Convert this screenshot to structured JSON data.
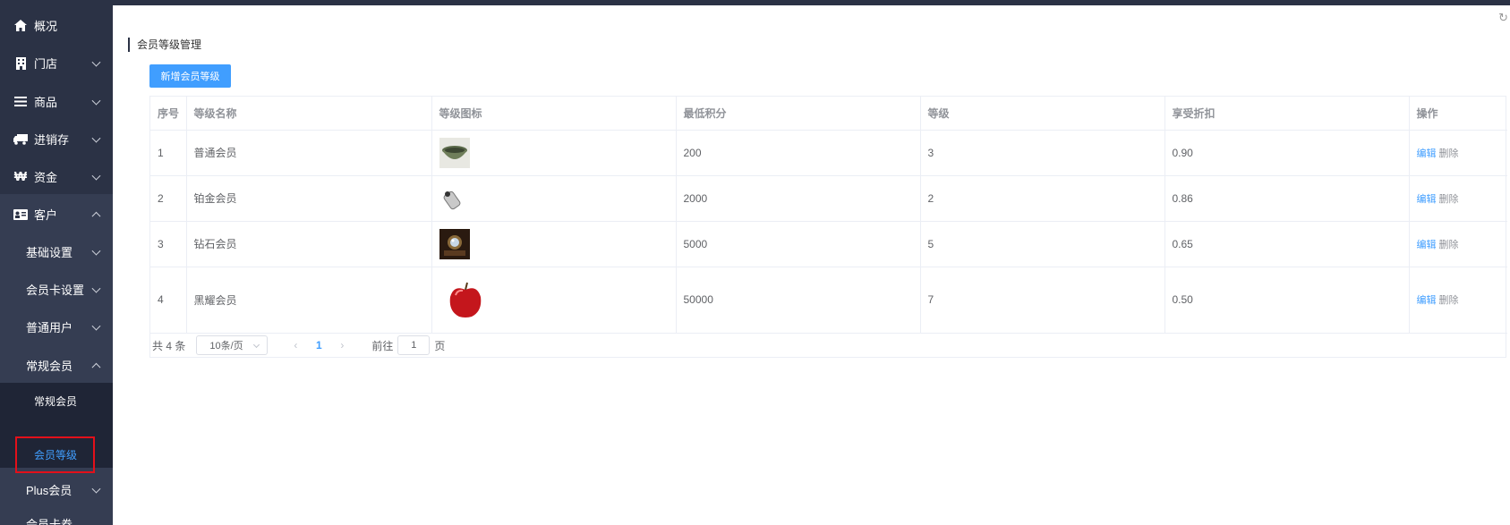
{
  "sidebar": {
    "items": [
      {
        "label": "概况",
        "icon": "home-icon"
      },
      {
        "label": "门店",
        "icon": "building-icon"
      },
      {
        "label": "商品",
        "icon": "list-icon"
      },
      {
        "label": "进销存",
        "icon": "truck-icon"
      },
      {
        "label": "资金",
        "icon": "won-icon"
      },
      {
        "label": "客户",
        "icon": "id-card-icon"
      }
    ],
    "customer_sub": [
      {
        "label": "基础设置"
      },
      {
        "label": "会员卡设置"
      },
      {
        "label": "普通用户"
      },
      {
        "label": "常规会员"
      }
    ],
    "regular_member_sub": [
      {
        "label": "常规会员"
      },
      {
        "label": "会员等级",
        "active": true
      }
    ],
    "plus_member": {
      "label": "Plus会员"
    },
    "bottom_cut": {
      "label": "会员卡券"
    }
  },
  "main": {
    "page_title": "会员等级管理",
    "add_button": "新增会员等级",
    "table": {
      "headers": [
        "序号",
        "等级名称",
        "等级图标",
        "最低积分",
        "等级",
        "享受折扣",
        "操作"
      ],
      "rows": [
        {
          "index": "1",
          "name": "普通会员",
          "icon": "bowl",
          "min_points": "200",
          "level": "3",
          "discount": "0.90"
        },
        {
          "index": "2",
          "name": "铂金会员",
          "icon": "silver-device",
          "min_points": "2000",
          "level": "2",
          "discount": "0.86"
        },
        {
          "index": "3",
          "name": "钻石会员",
          "icon": "diamond-ring",
          "min_points": "5000",
          "level": "5",
          "discount": "0.65"
        },
        {
          "index": "4",
          "name": "黑耀会员",
          "icon": "apple",
          "min_points": "50000",
          "level": "7",
          "discount": "0.50"
        }
      ],
      "edit_label": "编辑",
      "delete_label": "删除"
    },
    "pagination": {
      "total": "共 4 条",
      "page_size": "10条/页",
      "current_page": "1",
      "goto_label": "前往",
      "goto_value": "1",
      "page_suffix": "页"
    }
  },
  "colors": {
    "sidebar_bg": "#2b3245",
    "accent": "#409eff",
    "highlight_border": "#e3101a"
  }
}
